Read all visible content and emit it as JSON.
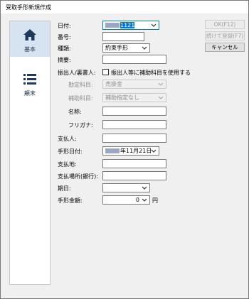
{
  "window": {
    "title": "受取手形新規作成"
  },
  "sidebar": {
    "items": [
      {
        "label": "基本",
        "icon": "home-icon",
        "active": true
      },
      {
        "label": "顛末",
        "icon": "list-icon",
        "active": false
      }
    ]
  },
  "buttons": {
    "ok": "OK(F12)",
    "continue": "続けて登録(F7)",
    "cancel": "キャンセル"
  },
  "form": {
    "date": {
      "label": "日付:",
      "value": "1121"
    },
    "number": {
      "label": "番号:",
      "value": ""
    },
    "type": {
      "label": "種類:",
      "value": "約束手形"
    },
    "memo": {
      "label": "摘要:",
      "value": ""
    },
    "drawer": {
      "label": "振出人/裏書人:",
      "checkbox_label": "振出人等に補助科目を使用する"
    },
    "account": {
      "label": "勘定科目:",
      "value": "売掛金"
    },
    "subaccount": {
      "label": "補助科目:",
      "value": "補助指定なし"
    },
    "name": {
      "label": "名称:",
      "value": ""
    },
    "furigana": {
      "label": "フリガナ:",
      "value": ""
    },
    "payer": {
      "label": "支払人:",
      "value": ""
    },
    "note_date": {
      "label": "手形日付:",
      "value": "年11月21日"
    },
    "pay_place": {
      "label": "支払地:",
      "value": ""
    },
    "pay_bank": {
      "label": "支払場所(銀行):",
      "value": ""
    },
    "due": {
      "label": "期日:",
      "value": ""
    },
    "amount": {
      "label": "手形金額:",
      "value": "0",
      "unit": "円"
    }
  }
}
